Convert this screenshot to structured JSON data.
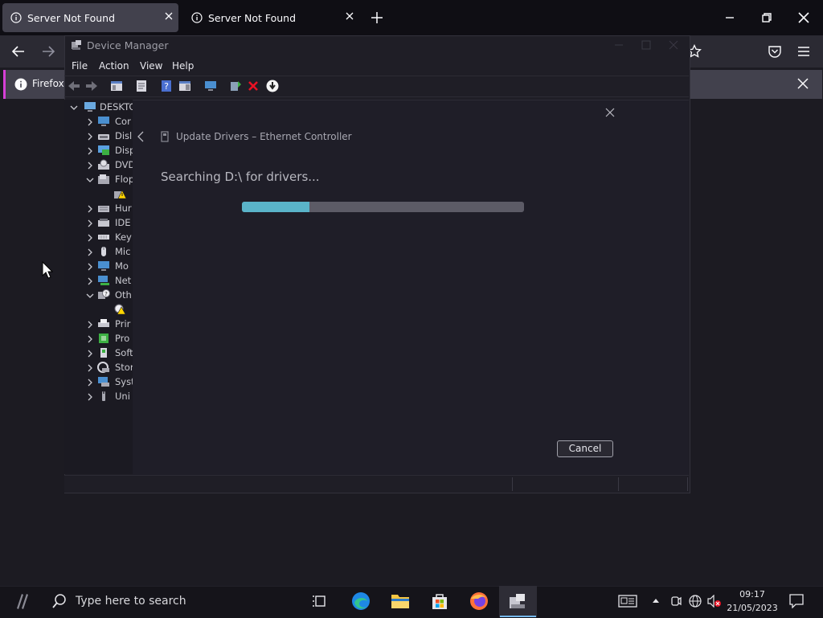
{
  "browser": {
    "tabs": [
      {
        "title": "Server Not Found",
        "active": true
      },
      {
        "title": "Server Not Found",
        "active": false
      }
    ],
    "notification_text": "Firefox"
  },
  "device_manager": {
    "title": "Device Manager",
    "menu": [
      "File",
      "Action",
      "View",
      "Help"
    ],
    "tree": [
      {
        "label": "DESKTC",
        "expanded": true,
        "level": 0,
        "icon": "computer-icon"
      },
      {
        "label": "Cor",
        "expanded": false,
        "level": 1,
        "icon": "monitor-icon"
      },
      {
        "label": "Disl",
        "expanded": false,
        "level": 1,
        "icon": "disk-drive-icon"
      },
      {
        "label": "Disp",
        "expanded": false,
        "level": 1,
        "icon": "display-adapter-icon"
      },
      {
        "label": "DVD",
        "expanded": false,
        "level": 1,
        "icon": "dvd-drive-icon"
      },
      {
        "label": "Flop",
        "expanded": true,
        "level": 1,
        "icon": "floppy-controller-icon"
      },
      {
        "label": "",
        "expanded": null,
        "level": 2,
        "icon": "warning-device-icon"
      },
      {
        "label": "Hur",
        "expanded": false,
        "level": 1,
        "icon": "hid-icon"
      },
      {
        "label": "IDE",
        "expanded": false,
        "level": 1,
        "icon": "ide-icon"
      },
      {
        "label": "Key",
        "expanded": false,
        "level": 1,
        "icon": "keyboard-icon"
      },
      {
        "label": "Mic",
        "expanded": false,
        "level": 1,
        "icon": "mouse-icon"
      },
      {
        "label": "Mo",
        "expanded": false,
        "level": 1,
        "icon": "monitor-icon"
      },
      {
        "label": "Net",
        "expanded": false,
        "level": 1,
        "icon": "network-adapter-icon"
      },
      {
        "label": "Oth",
        "expanded": true,
        "level": 1,
        "icon": "other-devices-icon"
      },
      {
        "label": "",
        "expanded": null,
        "level": 2,
        "icon": "unknown-device-icon"
      },
      {
        "label": "Prir",
        "expanded": false,
        "level": 1,
        "icon": "printer-icon"
      },
      {
        "label": "Pro",
        "expanded": false,
        "level": 1,
        "icon": "processor-icon"
      },
      {
        "label": "Soft",
        "expanded": false,
        "level": 1,
        "icon": "software-device-icon"
      },
      {
        "label": "Stor",
        "expanded": false,
        "level": 1,
        "icon": "storage-icon"
      },
      {
        "label": "Syst",
        "expanded": false,
        "level": 1,
        "icon": "system-devices-icon"
      },
      {
        "label": "Uni",
        "expanded": false,
        "level": 1,
        "icon": "usb-icon"
      }
    ]
  },
  "update_dialog": {
    "heading": "Update Drivers – Ethernet Controller",
    "status": "Searching D:\\ for drivers...",
    "progress_fraction": 0.24,
    "cancel_label": "Cancel"
  },
  "taskbar": {
    "search_placeholder": "Type here to search",
    "time": "09:17",
    "date": "21/05/2023"
  },
  "colors": {
    "accent": "#5ab4c9",
    "notification_stripe": "#d63fd6",
    "error_red": "#e81123"
  }
}
